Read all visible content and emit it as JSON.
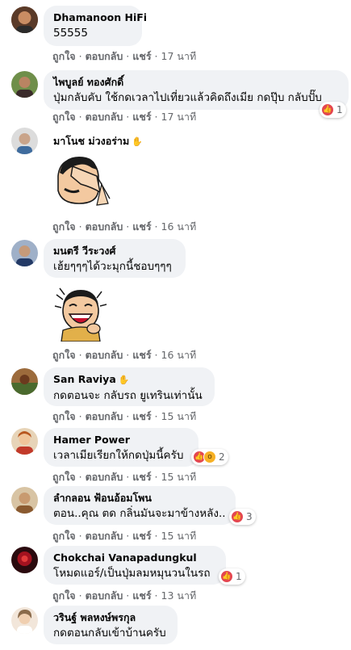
{
  "actions": {
    "like": "ถูกใจ",
    "reply": "ตอบกลับ",
    "share": "แชร์",
    "sep": "·"
  },
  "comments": [
    {
      "author": "Dhamanoon HiFi",
      "text": "55555",
      "time": "17 นาที",
      "reaction_count": "",
      "avatar_color": "#8a5a3c"
    },
    {
      "author": "ไพบูลย์ ทองศักดิ์",
      "text": "ปุ่มกลับคับ ใช้กดเวลาไปเที่ยวแล้วคิดถึงเมีย กดปุ๊บ กลับปั๊บ",
      "time": "17 นาที",
      "reaction_count": "1",
      "avatar_color": "#4e6b3a"
    },
    {
      "author": "มาโนช ม่วงอร่าม",
      "text": "",
      "time": "16 นาที",
      "reaction_count": "",
      "avatar_color": "#c9a48a",
      "sticker": "facepalm-sticker"
    },
    {
      "author": "มนตรี วีระวงศ์",
      "text": "เฮ้ยๆๆๆได้วะมุกนี้ชอบๆๆๆ",
      "time": "16 นาที",
      "reaction_count": "",
      "avatar_color": "#3c4f7a",
      "sticker": "laughing-sticker"
    },
    {
      "author": "San Raviya",
      "text": "กดตอนจะ กลับรถ ยูเทรินเท่านั้น",
      "time": "15 นาที",
      "reaction_count": "",
      "avatar_color": "#7a4a2a"
    },
    {
      "author": "Hamer Power",
      "text": "เวลาเมียเรียกให้กดปุ่มนี้ครับ",
      "time": "15 นาที",
      "reaction_count": "2",
      "avatar_color": "#b06a3a"
    },
    {
      "author": "ลำกลอน ฟ้อนอ้อมโพน",
      "text": "ตอน..คุณ ตด กลิ่นมันจะมาข้างหลัง..",
      "time": "15 นาที",
      "reaction_count": "3",
      "avatar_color": "#c8a070"
    },
    {
      "author": "Chokchai Vanapadungkul",
      "text": "โหมดแอร์/เป็นปุ่มลมหมุนวนในรถ",
      "time": "13 นาที",
      "reaction_count": "1",
      "avatar_color": "#7a1620"
    },
    {
      "author": "วรินฐ์ พลหงษ์พรกุล",
      "text": "กดตอนกลับเข้าบ้านครับ",
      "time": "",
      "reaction_count": "",
      "avatar_color": "#e8d5c0"
    }
  ],
  "colors": {
    "bubble": "#f0f2f5",
    "muted": "#65676b",
    "like_reaction": "#e4474f",
    "wow_reaction": "#f7b125"
  }
}
